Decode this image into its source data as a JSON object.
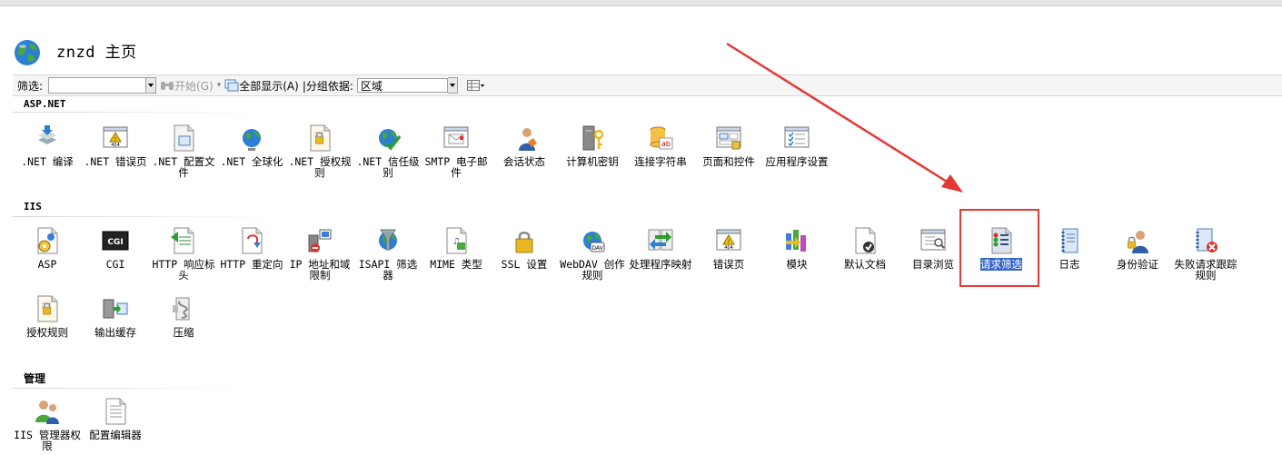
{
  "header": {
    "title": "znzd 主页",
    "icon": "globe-icon"
  },
  "toolbar": {
    "filter_label": "筛选:",
    "filter_value": "",
    "start_label": "开始(G)",
    "show_all_label": "全部显示(A)",
    "group_by_label": "|分组依据:",
    "group_by_value": "区域"
  },
  "sections": [
    {
      "title": "ASP.NET",
      "items": [
        {
          "label": ".NET 编译",
          "icon": "net-compile-icon"
        },
        {
          "label": ".NET 错误页",
          "icon": "net-error-page-icon"
        },
        {
          "label": ".NET 配置文件",
          "icon": "net-profile-icon"
        },
        {
          "label": ".NET 全球化",
          "icon": "net-globalization-icon"
        },
        {
          "label": ".NET 授权规则",
          "icon": "net-authorization-icon"
        },
        {
          "label": ".NET 信任级别",
          "icon": "net-trust-icon"
        },
        {
          "label": "SMTP 电子邮件",
          "icon": "smtp-email-icon"
        },
        {
          "label": "会话状态",
          "icon": "session-state-icon"
        },
        {
          "label": "计算机密钥",
          "icon": "machine-key-icon"
        },
        {
          "label": "连接字符串",
          "icon": "connection-string-icon"
        },
        {
          "label": "页面和控件",
          "icon": "pages-controls-icon"
        },
        {
          "label": "应用程序设置",
          "icon": "app-settings-icon"
        }
      ]
    },
    {
      "title": "IIS",
      "items": [
        {
          "label": "ASP",
          "icon": "asp-icon"
        },
        {
          "label": "CGI",
          "icon": "cgi-icon"
        },
        {
          "label": "HTTP 响应标头",
          "icon": "http-headers-icon"
        },
        {
          "label": "HTTP 重定向",
          "icon": "http-redirect-icon"
        },
        {
          "label": "IP 地址和域限制",
          "icon": "ip-restrictions-icon"
        },
        {
          "label": "ISAPI 筛选器",
          "icon": "isapi-filter-icon"
        },
        {
          "label": "MIME 类型",
          "icon": "mime-type-icon"
        },
        {
          "label": "SSL 设置",
          "icon": "ssl-lock-icon"
        },
        {
          "label": "WebDAV 创作规则",
          "icon": "webdav-icon"
        },
        {
          "label": "处理程序映射",
          "icon": "handler-mapping-icon"
        },
        {
          "label": "错误页",
          "icon": "error-page-icon"
        },
        {
          "label": "模块",
          "icon": "modules-icon"
        },
        {
          "label": "默认文档",
          "icon": "default-document-icon"
        },
        {
          "label": "目录浏览",
          "icon": "directory-browsing-icon"
        },
        {
          "label": "请求筛选",
          "icon": "request-filtering-icon",
          "selected": true
        },
        {
          "label": "日志",
          "icon": "logging-icon"
        },
        {
          "label": "身份验证",
          "icon": "authentication-icon"
        },
        {
          "label": "失败请求跟踪规则",
          "icon": "failed-request-tracing-icon"
        },
        {
          "label": "授权规则",
          "icon": "authorization-rules-icon"
        },
        {
          "label": "输出缓存",
          "icon": "output-cache-icon"
        },
        {
          "label": "压缩",
          "icon": "compression-icon"
        }
      ]
    },
    {
      "title": "管理",
      "items": [
        {
          "label": "IIS 管理器权限",
          "icon": "iis-manager-permissions-icon"
        },
        {
          "label": "配置编辑器",
          "icon": "configuration-editor-icon"
        }
      ]
    }
  ],
  "colors": {
    "annotation": "#e53935",
    "selection": "#3366cc"
  }
}
